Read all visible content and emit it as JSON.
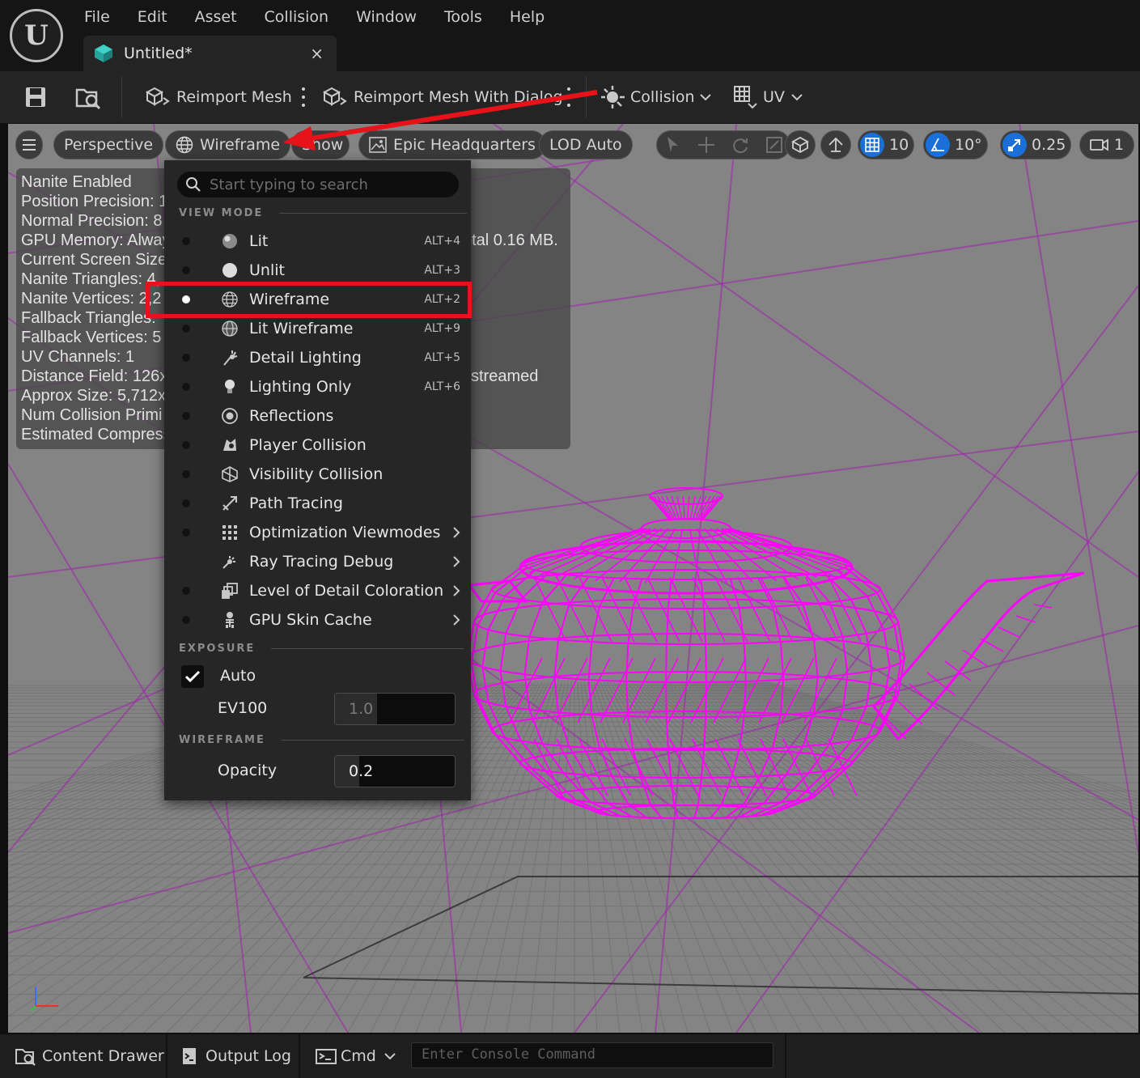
{
  "menubar": {
    "items": [
      "File",
      "Edit",
      "Asset",
      "Collision",
      "Window",
      "Tools",
      "Help"
    ]
  },
  "tab": {
    "title": "Untitled*",
    "close": "×"
  },
  "toolbar": {
    "reimport_mesh": "Reimport Mesh",
    "reimport_mesh_dialog": "Reimport Mesh With Dialog",
    "collision": "Collision",
    "uv": "UV"
  },
  "viewport": {
    "perspective": "Perspective",
    "view_mode": "Wireframe",
    "show": "Show",
    "preview_scene": "Epic Headquarters",
    "lod": "LOD Auto",
    "grid_snap": "10",
    "rotation_snap": "10°",
    "scale_snap": "0.25",
    "camera_speed": "1",
    "stats": [
      "Nanite Enabled",
      "Position Precision: 1",
      "Normal Precision: 8",
      "GPU Memory: Alway",
      "Current Screen Size:",
      "Nanite Triangles:  4,",
      "Nanite Vertices:  2,2",
      "Fallback Triangles:",
      "Fallback Vertices:  5",
      "UV Channels:  1",
      "Distance Field:  126x",
      "Approx Size: 5,712x3",
      "Num Collision Primi",
      "Estimated Compress"
    ],
    "stats_total": "otal 0.16 MB.",
    "stats_streamed": "streamed"
  },
  "dropdown": {
    "search_placeholder": "Start typing to search",
    "view_mode_header": "VIEW MODE",
    "modes": [
      {
        "label": "Lit",
        "shortcut": "ALT+4",
        "icon": "lit-sphere-icon",
        "selected": false,
        "submenu": false,
        "dot": true
      },
      {
        "label": "Unlit",
        "shortcut": "ALT+3",
        "icon": "unlit-sphere-icon",
        "selected": false,
        "submenu": false,
        "dot": true
      },
      {
        "label": "Wireframe",
        "shortcut": "ALT+2",
        "icon": "wireframe-sphere-icon",
        "selected": true,
        "submenu": false,
        "dot": true
      },
      {
        "label": "Lit Wireframe",
        "shortcut": "ALT+9",
        "icon": "lit-wireframe-icon",
        "selected": false,
        "submenu": false,
        "dot": true
      },
      {
        "label": "Detail Lighting",
        "shortcut": "ALT+5",
        "icon": "detail-lighting-icon",
        "selected": false,
        "submenu": false,
        "dot": true
      },
      {
        "label": "Lighting Only",
        "shortcut": "ALT+6",
        "icon": "lightbulb-icon",
        "selected": false,
        "submenu": false,
        "dot": true
      },
      {
        "label": "Reflections",
        "shortcut": "",
        "icon": "reflections-icon",
        "selected": false,
        "submenu": false,
        "dot": true
      },
      {
        "label": "Player Collision",
        "shortcut": "",
        "icon": "player-collision-icon",
        "selected": false,
        "submenu": false,
        "dot": true
      },
      {
        "label": "Visibility Collision",
        "shortcut": "",
        "icon": "visibility-collision-icon",
        "selected": false,
        "submenu": false,
        "dot": true
      },
      {
        "label": "Path Tracing",
        "shortcut": "",
        "icon": "path-tracing-icon",
        "selected": false,
        "submenu": false,
        "dot": true
      },
      {
        "label": "Optimization Viewmodes",
        "shortcut": "",
        "icon": "optimization-grid-icon",
        "selected": false,
        "submenu": true,
        "dot": true
      },
      {
        "label": "Ray Tracing Debug",
        "shortcut": "",
        "icon": "ray-tracing-icon",
        "selected": false,
        "submenu": true,
        "dot": false
      },
      {
        "label": "Level of Detail Coloration",
        "shortcut": "",
        "icon": "lod-coloration-icon",
        "selected": false,
        "submenu": true,
        "dot": true
      },
      {
        "label": "GPU Skin Cache",
        "shortcut": "",
        "icon": "skeleton-icon",
        "selected": false,
        "submenu": true,
        "dot": true
      }
    ],
    "exposure_header": "EXPOSURE",
    "auto_label": "Auto",
    "auto_checked": true,
    "ev100_label": "EV100",
    "ev100_value": "1.0",
    "wireframe_header": "WIREFRAME",
    "opacity_label": "Opacity",
    "opacity_value": "0.2"
  },
  "bottombar": {
    "content_drawer": "Content Drawer",
    "output_log": "Output Log",
    "cmd": "Cmd",
    "console_placeholder": "Enter Console Command"
  },
  "colors": {
    "wireframe_mesh": "#ff00ff",
    "floor_grid": "#6e6e6e",
    "highlight": "#e8131a",
    "accent_blue": "#1a6fd8"
  }
}
